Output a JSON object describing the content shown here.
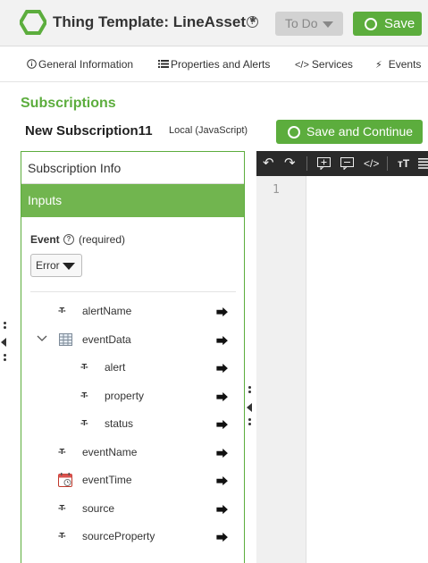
{
  "header": {
    "title": "Thing Template: LineAsset *",
    "help_icon": "?",
    "state_label": "To Do",
    "save_label": "Save"
  },
  "tabs": [
    {
      "label": "General Information",
      "icon": "info-icon"
    },
    {
      "label": "Properties and Alerts",
      "icon": "list-icon"
    },
    {
      "label": "Services",
      "icon": "code-icon"
    },
    {
      "label": "Events",
      "icon": "bolt-icon"
    }
  ],
  "section": {
    "title": "Subscriptions",
    "subscription_name": "New Subscription11",
    "subscription_type": "Local (JavaScript)",
    "save_continue_label": "Save and Continue"
  },
  "left_panel": {
    "subscription_info_label": "Subscription Info",
    "inputs_label": "Inputs",
    "event_label": "Event",
    "event_required": "(required)",
    "event_value": "Error",
    "input_type_glyph": "-T-"
  },
  "inputs": [
    {
      "label": "alertName",
      "type": "string",
      "indent": 0
    },
    {
      "label": "eventData",
      "type": "infotable",
      "indent": 0,
      "expanded": true
    },
    {
      "label": "alert",
      "type": "string",
      "indent": 1
    },
    {
      "label": "property",
      "type": "string",
      "indent": 1
    },
    {
      "label": "status",
      "type": "string",
      "indent": 1
    },
    {
      "label": "eventName",
      "type": "string",
      "indent": 0
    },
    {
      "label": "eventTime",
      "type": "datetime",
      "indent": 0
    },
    {
      "label": "source",
      "type": "string",
      "indent": 0
    },
    {
      "label": "sourceProperty",
      "type": "string",
      "indent": 0
    }
  ],
  "editor": {
    "line_numbers": [
      "1"
    ],
    "toolbar": [
      "undo-icon",
      "redo-icon",
      "add-snippet-icon",
      "comment-icon",
      "code-tag-icon",
      "font-size-icon",
      "format-icon"
    ]
  },
  "colors": {
    "accent": "#5cad3d",
    "inputs_header": "#71b54f",
    "editor_toolbar": "#2a2a2a"
  }
}
